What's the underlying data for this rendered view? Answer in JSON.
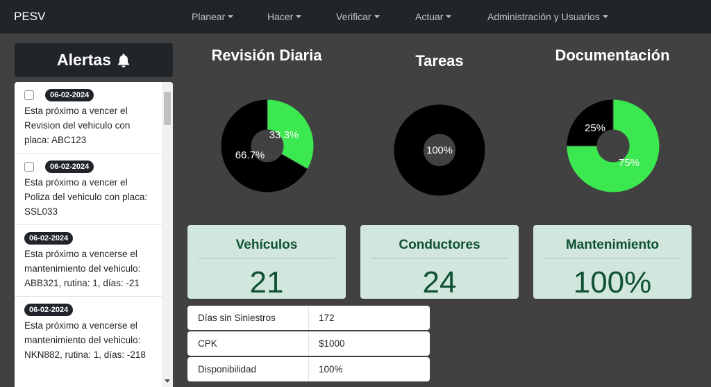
{
  "navbar": {
    "brand": "PESV",
    "items": [
      {
        "label": "Planear"
      },
      {
        "label": "Hacer"
      },
      {
        "label": "Verificar"
      },
      {
        "label": "Actuar"
      },
      {
        "label": "Administración y Usuarios"
      }
    ]
  },
  "alerts": {
    "title": "Alertas",
    "icon": "bell-icon",
    "items": [
      {
        "date": "06-02-2024",
        "checkbox": true,
        "text": "Esta próximo a vencer el Revision del vehiculo con placa: ABC123"
      },
      {
        "date": "06-02-2024",
        "checkbox": true,
        "text": "Esta próximo a vencer el Poliza del vehiculo con placa: SSL033"
      },
      {
        "date": "06-02-2024",
        "checkbox": false,
        "text": "Esta próximo a vencerse el mantenimiento del vehiculo: ABB321, rutina: 1, días: -21"
      },
      {
        "date": "06-02-2024",
        "checkbox": false,
        "text": "Esta próximo a vencerse el mantenimiento del vehiculo: NKN882, rutina: 1, días: -218"
      }
    ]
  },
  "charts": {
    "colors": {
      "green": "#3ce84f",
      "black": "#000000"
    },
    "revision": {
      "title": "Revisión Diaria",
      "labels": [
        "33.3%",
        "66.7%"
      ]
    },
    "tareas": {
      "title": "Tareas",
      "labels": [
        "100%"
      ]
    },
    "documentacion": {
      "title": "Documentación",
      "labels": [
        "25%",
        "75%"
      ]
    }
  },
  "chart_data": [
    {
      "type": "pie",
      "title": "Revisión Diaria",
      "slices": [
        {
          "value": 33.3,
          "color": "#3ce84f"
        },
        {
          "value": 66.7,
          "color": "#000000"
        }
      ]
    },
    {
      "type": "pie",
      "title": "Tareas",
      "slices": [
        {
          "value": 100,
          "color": "#000000"
        }
      ]
    },
    {
      "type": "pie",
      "title": "Documentación",
      "slices": [
        {
          "value": 75,
          "color": "#3ce84f"
        },
        {
          "value": 25,
          "color": "#000000"
        }
      ]
    }
  ],
  "stats": {
    "vehiculos": {
      "label": "Vehículos",
      "value": "21"
    },
    "conductores": {
      "label": "Conductores",
      "value": "24"
    },
    "mantenimiento": {
      "label": "Mantenimiento",
      "value": "100%"
    }
  },
  "metrics": [
    {
      "name": "Días sin Siniestros",
      "value": "172"
    },
    {
      "name": "CPK",
      "value": "$1000"
    },
    {
      "name": "Disponibilidad",
      "value": "100%"
    }
  ]
}
